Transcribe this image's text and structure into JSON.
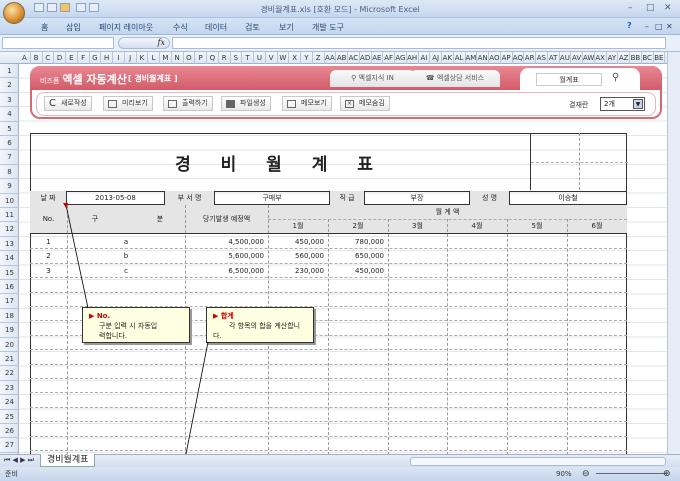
{
  "window": {
    "title": "경비월계표.xls  [호환 모드] - Microsoft Excel",
    "minimize": "–",
    "maximize": "□",
    "close": "✕",
    "help_icon": "?"
  },
  "ribbon": {
    "tabs": [
      "홈",
      "삽입",
      "페이지 레이아웃",
      "수식",
      "데이터",
      "검토",
      "보기",
      "개발 도구"
    ]
  },
  "formula_bar": {
    "fx": "fx",
    "name_box": "",
    "value": ""
  },
  "columns": [
    "A",
    "B",
    "C",
    "D",
    "E",
    "F",
    "G",
    "H",
    "I",
    "J",
    "K",
    "L",
    "M",
    "N",
    "O",
    "P",
    "Q",
    "R",
    "S",
    "T",
    "U",
    "V",
    "W",
    "X",
    "Y",
    "Z",
    "AA",
    "AB",
    "AC",
    "AD",
    "AE",
    "AF",
    "AG",
    "AH",
    "AI",
    "AJ",
    "AK",
    "AL",
    "AM",
    "AN",
    "AO",
    "AP",
    "AQ",
    "AR",
    "AS",
    "AT",
    "AU",
    "AV",
    "AW",
    "AX",
    "AY",
    "AZ",
    "BB",
    "BC",
    "BE"
  ],
  "rows": [
    "1",
    "2",
    "3",
    "4",
    "5",
    "6",
    "7",
    "8",
    "9",
    "10",
    "11",
    "12",
    "13",
    "14",
    "15",
    "16",
    "17",
    "18",
    "19",
    "20",
    "21",
    "22",
    "23",
    "24",
    "25",
    "26",
    "27"
  ],
  "header": {
    "brand_small": "비즈폼",
    "brand": "엑셀 자동계산",
    "subtitle": "[ 경비월계표 ]",
    "tab1": "엑셀지식 IN",
    "tab2": "엑셀상담 서비스",
    "search_value": "월계표",
    "buttons": [
      "새로작성",
      "미리보기",
      "출력하기",
      "파일생성",
      "메모보기",
      "메모숨김"
    ],
    "approval_label": "결재란",
    "approval_value": "2개"
  },
  "form": {
    "title": "경 비 월 계 표",
    "info": {
      "date_label": "날 짜",
      "date": "2013-05-08",
      "dept_label": "부 서 명",
      "dept": "구매부",
      "rank_label": "직 급",
      "rank": "부장",
      "name_label": "성 명",
      "name": "이승철"
    },
    "head": {
      "no": "No.",
      "cat1": "구",
      "cat2": "분",
      "budget": "당기발생 예정액",
      "monthly": "월     계     액",
      "months": [
        "1월",
        "2월",
        "3월",
        "4월",
        "5월",
        "6월"
      ]
    },
    "rows": [
      {
        "no": "1",
        "cat": "a",
        "budget": "4,500,000",
        "m": [
          "450,000",
          "780,000",
          "",
          "",
          "",
          ""
        ]
      },
      {
        "no": "2",
        "cat": "b",
        "budget": "5,600,000",
        "m": [
          "560,000",
          "650,000",
          "",
          "",
          "",
          ""
        ]
      },
      {
        "no": "3",
        "cat": "c",
        "budget": "6,500,000",
        "m": [
          "230,000",
          "450,000",
          "",
          "",
          "",
          ""
        ]
      }
    ]
  },
  "memos": [
    {
      "title": "▶ No.",
      "text": "구분 입력 시 자동입력합니다."
    },
    {
      "title": "▶ 합계",
      "text": "각 항목의 합을 계산합니다."
    }
  ],
  "sheet_tab": "경비월계표",
  "status": {
    "ready": "준비",
    "zoom": "90%"
  },
  "colors": {
    "accent": "#d35b69",
    "memo": "#ffffe1"
  }
}
